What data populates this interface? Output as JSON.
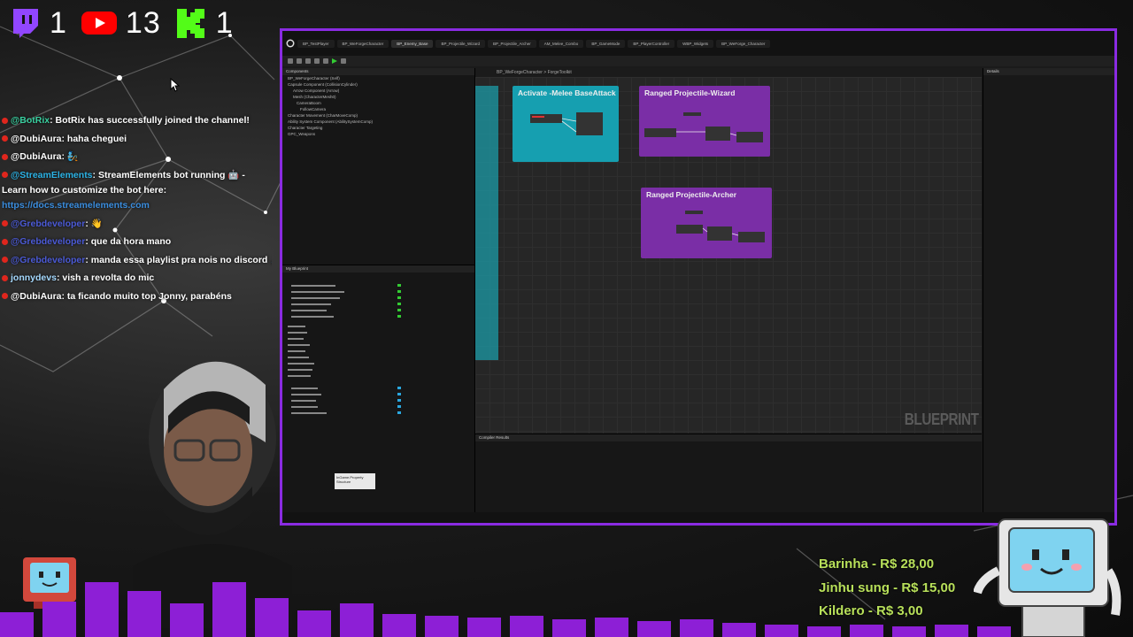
{
  "stats": [
    {
      "platform": "twitch-icon",
      "color": "#9146ff",
      "count": "1"
    },
    {
      "platform": "youtube-icon",
      "color": "#ff0000",
      "count": "13"
    },
    {
      "platform": "kick-icon",
      "color": "#53fc18",
      "count": "1"
    }
  ],
  "chat": {
    "messages": [
      {
        "user": "@BotRix",
        "user_color": "#39d0a0",
        "text": ": BotRix has successfully joined the channel!"
      },
      {
        "user": "@DubiAura",
        "user_color": "#ffffff",
        "text": ": haha cheguei"
      },
      {
        "user": "@DubiAura",
        "user_color": "#ffffff",
        "text": ": 🧞"
      },
      {
        "user": "@StreamElements",
        "user_color": "#2bb3e6",
        "text": ": StreamElements bot running 🤖 - Learn how to customize the bot here: ",
        "link": "https://docs.streamelements.com"
      },
      {
        "user": "@Grebdeveloper",
        "user_color": "#4b5ad6",
        "text": ": 👋"
      },
      {
        "user": "@Grebdeveloper",
        "user_color": "#4b5ad6",
        "text": ": que da hora mano"
      },
      {
        "user": "@Grebdeveloper",
        "user_color": "#4b5ad6",
        "text": ": manda essa playlist pra nois no discord 🙏"
      },
      {
        "user": "jonnydevs",
        "user_color": "#a5d9ff",
        "text": ": vish a revolta do mic"
      },
      {
        "user": "@DubiAura",
        "user_color": "#ffffff",
        "text": ": ta ficando muito top Jonny, parabéns"
      }
    ]
  },
  "editor": {
    "tabs": [
      "BP_TestPlayer",
      "BP_WeForgeCharacter",
      "BP_Enemy_Base",
      "BP_Projectile_Wizard",
      "BP_Projectile_Archer",
      "AM_Melee_Combo",
      "BP_GameMode",
      "BP_PlayerController",
      "WBP_Widgets",
      "BP_WeForge_Character"
    ],
    "breadcrumb": "BP_WeForgeCharacter > ForgeToolkit",
    "panels": {
      "components": "Components",
      "my_blueprint": "My Blueprint",
      "compiler": "Compiler Results",
      "details": "Details"
    },
    "tree_items": [
      "BP_WeForgeCharacter (Self)",
      "Capsule Component (CollisionCylinder)",
      "Arrow Component (Arrow)",
      "Mesh (CharacterMesh0)",
      "CameraBoom",
      "FollowCamera",
      "Character Movement (CharMoveComp)",
      "Ability System Component (AbilitySystemComp)",
      "Character Targeting",
      "GPC_Weapons"
    ],
    "nodes": [
      {
        "title": "Activate -Melee BaseAttack",
        "color": "#18a8b8"
      },
      {
        "title": "Ranged Projectile-Wizard",
        "color": "#7a2ea6"
      },
      {
        "title": "Ranged Projectile-Archer",
        "color": "#7a2ea6"
      }
    ],
    "watermark": "BLUEPRINT",
    "tooltip": "InGame.Property Structure"
  },
  "donations": [
    "Barinha - R$ 28,00",
    "Jinhu sung - R$ 15,00",
    "Kildero - R$ 3,00"
  ],
  "colors": {
    "accent_purple": "#8a2be2",
    "bar_purple": "#8d1fd6",
    "donation_green": "#b8e05a"
  }
}
